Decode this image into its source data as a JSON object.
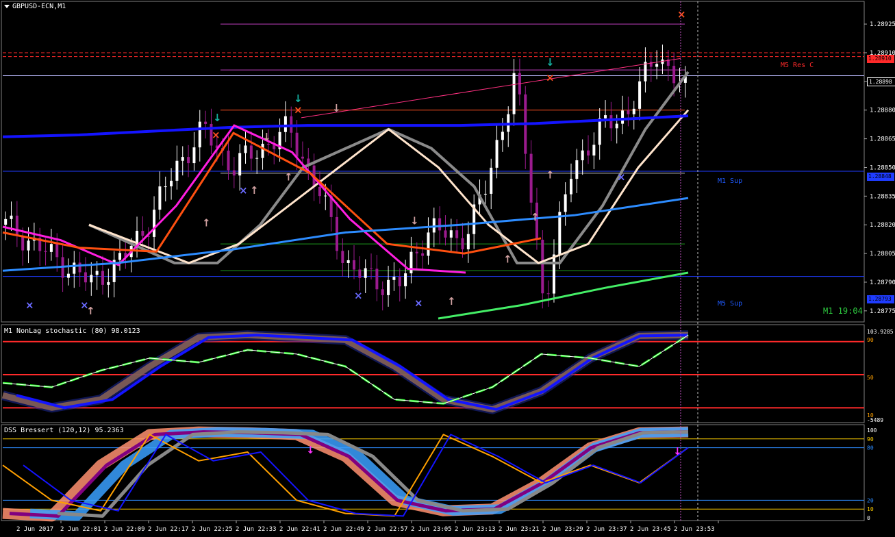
{
  "header": {
    "symbol_title": "GBPUSD-ECN,M1",
    "stoch_title": "M1 NonLag stochastic (80) 98.0123",
    "dss_title": "DSS Bressert (120,12) 95.2363"
  },
  "levels": {
    "m1_sup_label": "M1 Sup",
    "m5_sup_label": "M5 Sup",
    "m5_res_label": "M5 Res C",
    "clock": "M1 19:04",
    "res_price": "1.28910",
    "current_price": "1.28898",
    "m1_sup_price": "1.28848",
    "m5_sup_price": "1.28793"
  },
  "colors": {
    "background": "#000000",
    "bull_candle": "#ffffff",
    "bear_candle": "#9b1b8e",
    "ma_gray": "#8a8a8a",
    "ma_peach": "#ffe4cc",
    "ma_magenta": "#ff1ee0",
    "ma_orange": "#ff5010",
    "ma_blue": "#1414ff",
    "ma_yellow": "#ffd000",
    "ma_sky": "#2d8cff",
    "ma_green": "#44ee66",
    "support_line": "#1f3cff",
    "resistance_line": "#ff2a2a"
  },
  "chart_data": [
    {
      "type": "line",
      "title": "GBPUSD-ECN,M1",
      "x_labels": [
        "2 Jun 2017",
        "2 Jun 22:01",
        "2 Jun 22:09",
        "2 Jun 22:17",
        "2 Jun 22:25",
        "2 Jun 22:33",
        "2 Jun 22:41",
        "2 Jun 22:49",
        "2 Jun 22:57",
        "2 Jun 23:05",
        "2 Jun 23:13",
        "2 Jun 23:21",
        "2 Jun 23:29",
        "2 Jun 23:37",
        "2 Jun 23:45",
        "2 Jun 23:53"
      ],
      "y_ticks": [
        "1.28925",
        "1.28910",
        "1.28895",
        "1.28880",
        "1.28865",
        "1.28850",
        "1.28835",
        "1.28820",
        "1.28805",
        "1.28790",
        "1.28775"
      ],
      "ylim": [
        1.28771,
        1.28934
      ],
      "approx_close": [
        1.2882,
        1.2881,
        1.288,
        1.2879,
        1.288,
        1.2882,
        1.2885,
        1.2887,
        1.2885,
        1.2886,
        1.2887,
        1.2884,
        1.288,
        1.2879,
        1.2879,
        1.2882,
        1.2881,
        1.2884,
        1.289,
        1.2878,
        1.2885,
        1.2887,
        1.2888,
        1.2891,
        1.2889
      ],
      "series": [
        {
          "name": "",
          "values": [
            1.2882,
            1.2881,
            1.288,
            1.288,
            1.2882,
            1.2885,
            1.2886,
            1.2887,
            1.2886,
            1.2884,
            1.288,
            1.288,
            1.2883,
            1.2887,
            1.289
          ]
        },
        {
          "name": "",
          "values": [
            1.2882,
            1.2881,
            1.288,
            1.2881,
            1.2883,
            1.2885,
            1.2887,
            1.2885,
            1.2882,
            1.288,
            1.2881,
            1.2885,
            1.2888
          ]
        }
      ]
    },
    {
      "type": "line",
      "title": "M1 NonLag stochastic (80) 98.0123",
      "y_ticks": [
        "103.9285",
        "90",
        "50",
        "10",
        "-5489"
      ],
      "ylim": [
        -5.49,
        103.93
      ],
      "series": [
        {
          "name": "",
          "values": [
            25,
            10,
            20,
            60,
            95,
            98,
            95,
            92,
            60,
            20,
            8,
            30,
            70,
            97,
            98
          ]
        },
        {
          "name": "",
          "values": [
            40,
            35,
            55,
            70,
            65,
            80,
            75,
            60,
            20,
            15,
            35,
            75,
            70,
            60,
            98
          ]
        }
      ]
    },
    {
      "type": "line",
      "title": "DSS Bressert (120,12) 95.2363",
      "y_ticks": [
        "100",
        "90",
        "80",
        "20",
        "10",
        "0"
      ],
      "ylim": [
        0,
        100
      ],
      "series": [
        {
          "name": "",
          "values": [
            5,
            2,
            60,
            95,
            98,
            97,
            95,
            70,
            20,
            8,
            10,
            40,
            80,
            97,
            98
          ]
        },
        {
          "name": "",
          "values": [
            60,
            20,
            8,
            95,
            65,
            75,
            20,
            5,
            2,
            95,
            70,
            40,
            60,
            40,
            80
          ]
        }
      ]
    }
  ]
}
